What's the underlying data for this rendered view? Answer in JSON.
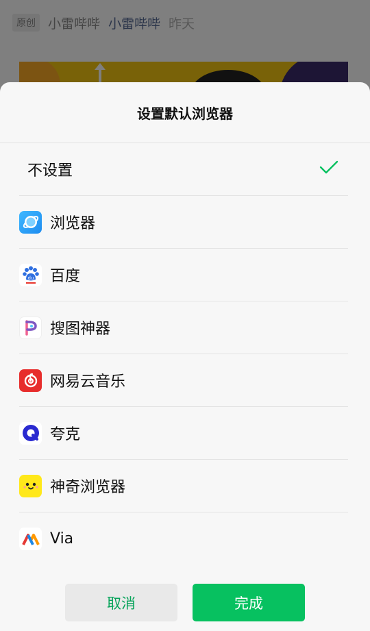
{
  "background": {
    "tag": "原创",
    "author": "小雷哔哔",
    "account": "小雷哔哔",
    "date": "昨天"
  },
  "sheet": {
    "title": "设置默认浏览器",
    "options": [
      {
        "label": "不设置",
        "icon": "none",
        "selected": true
      },
      {
        "label": "浏览器",
        "icon": "browser-icon",
        "selected": false
      },
      {
        "label": "百度",
        "icon": "baidu-icon",
        "selected": false
      },
      {
        "label": "搜图神器",
        "icon": "soutu-icon",
        "selected": false
      },
      {
        "label": "网易云音乐",
        "icon": "netease-music-icon",
        "selected": false
      },
      {
        "label": "夸克",
        "icon": "quark-icon",
        "selected": false
      },
      {
        "label": "神奇浏览器",
        "icon": "magic-browser-icon",
        "selected": false
      },
      {
        "label": "Via",
        "icon": "via-icon",
        "selected": false
      }
    ],
    "baidu_glyph": "du",
    "cancel_label": "取消",
    "done_label": "完成"
  },
  "colors": {
    "accent": "#07c160",
    "cancel_text": "#07a35a",
    "link": "#576b95"
  }
}
